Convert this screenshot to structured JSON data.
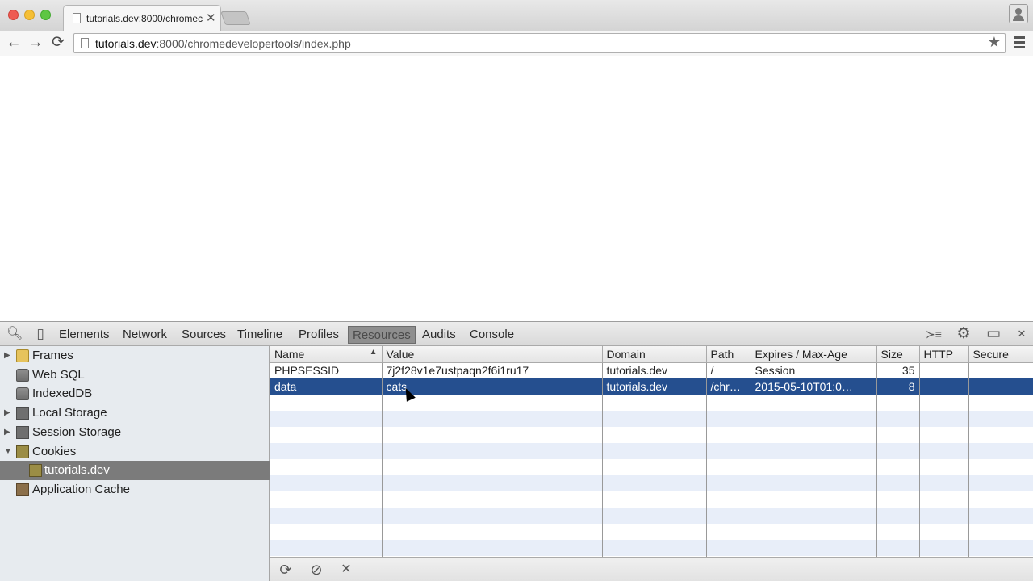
{
  "browser": {
    "tab_title": "tutorials.dev:8000/chromec",
    "tab_close": "✕",
    "url_host": "tutorials.dev",
    "url_rest": ":8000/chromedevelopertools/index.php",
    "back_icon": "←",
    "forward_icon": "→",
    "reload_icon": "⟳",
    "star_icon": "★"
  },
  "devtools": {
    "tabs": [
      "Elements",
      "Network",
      "Sources",
      "Timeline",
      "Profiles",
      "Resources",
      "Audits",
      "Console"
    ],
    "active_tab": "Resources",
    "sidebar": {
      "items": [
        {
          "label": "Frames",
          "icon": "folder-icon",
          "arrow": "▶"
        },
        {
          "label": "Web SQL",
          "icon": "database-icon",
          "arrow": ""
        },
        {
          "label": "IndexedDB",
          "icon": "database-icon",
          "arrow": ""
        },
        {
          "label": "Local Storage",
          "icon": "storage-icon",
          "arrow": "▶"
        },
        {
          "label": "Session Storage",
          "icon": "storage-icon",
          "arrow": "▶"
        },
        {
          "label": "Cookies",
          "icon": "cookie-icon",
          "arrow": "▼"
        },
        {
          "label": "tutorials.dev",
          "icon": "cookie-icon",
          "arrow": ""
        },
        {
          "label": "Application Cache",
          "icon": "app-cache-icon",
          "arrow": ""
        }
      ],
      "selected": "tutorials.dev"
    },
    "cookie_table": {
      "columns": [
        "Name",
        "Value",
        "Domain",
        "Path",
        "Expires / Max-Age",
        "Size",
        "HTTP",
        "Secure"
      ],
      "sort_indicator": "▲",
      "rows": [
        {
          "name": "PHPSESSID",
          "value": "7j2f28v1e7ustpaqn2f6i1ru17",
          "domain": "tutorials.dev",
          "path": "/",
          "expires": "Session",
          "size": "35",
          "http": "",
          "secure": ""
        },
        {
          "name": "data",
          "value": "cats",
          "domain": "tutorials.dev",
          "path": "/chr…",
          "expires": "2015-05-10T01:0…",
          "size": "8",
          "http": "",
          "secure": ""
        }
      ],
      "selected_row": 1
    },
    "status_icons": {
      "refresh": "⟳",
      "clear": "⊘",
      "delete": "✕"
    },
    "right_icons": {
      "console_drawer": "≻≡",
      "settings": "⚙",
      "dock": "▭",
      "close": "✕"
    }
  }
}
